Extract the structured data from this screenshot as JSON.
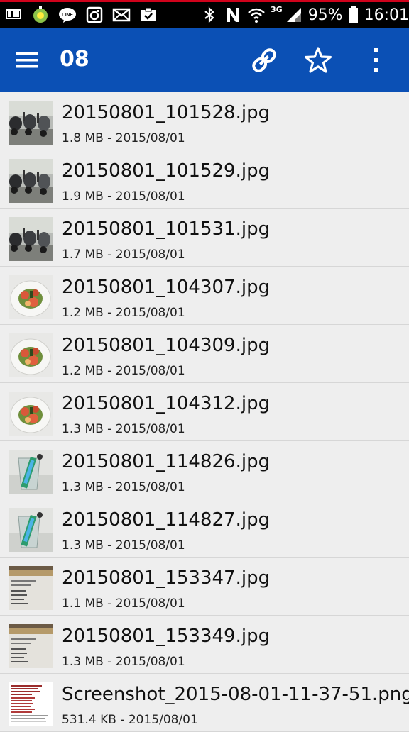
{
  "status_bar": {
    "notification_icons": [
      "line-icon",
      "timer-app-icon",
      "line-chat-icon",
      "instagram-icon",
      "mail-icon",
      "clipboard-check-icon"
    ],
    "network_type": "3G",
    "battery": "95%",
    "time": "16:01",
    "colors": {
      "background": "#000000",
      "top_line": "#d0021b"
    }
  },
  "app_bar": {
    "title": "08",
    "icons": [
      "menu-icon",
      "link-icon",
      "star-icon",
      "more-vert-icon"
    ],
    "color": "#0b50b5"
  },
  "files": [
    {
      "name": "20150801_101528.jpg",
      "meta": "1.8 MB - 2015/08/01",
      "thumb": "scooters"
    },
    {
      "name": "20150801_101529.jpg",
      "meta": "1.9 MB - 2015/08/01",
      "thumb": "scooters"
    },
    {
      "name": "20150801_101531.jpg",
      "meta": "1.7 MB - 2015/08/01",
      "thumb": "scooters"
    },
    {
      "name": "20150801_104307.jpg",
      "meta": "1.2 MB - 2015/08/01",
      "thumb": "salad"
    },
    {
      "name": "20150801_104309.jpg",
      "meta": "1.2 MB - 2015/08/01",
      "thumb": "salad"
    },
    {
      "name": "20150801_104312.jpg",
      "meta": "1.3 MB - 2015/08/01",
      "thumb": "salad"
    },
    {
      "name": "20150801_114826.jpg",
      "meta": "1.3 MB - 2015/08/01",
      "thumb": "glass"
    },
    {
      "name": "20150801_114827.jpg",
      "meta": "1.3 MB - 2015/08/01",
      "thumb": "glass"
    },
    {
      "name": "20150801_153347.jpg",
      "meta": "1.1 MB - 2015/08/01",
      "thumb": "document"
    },
    {
      "name": "20150801_153349.jpg",
      "meta": "1.3 MB - 2015/08/01",
      "thumb": "document"
    },
    {
      "name": "Screenshot_2015-08-01-11-37-51.png",
      "meta": "531.4 KB - 2015/08/01",
      "thumb": "screenshot"
    }
  ]
}
